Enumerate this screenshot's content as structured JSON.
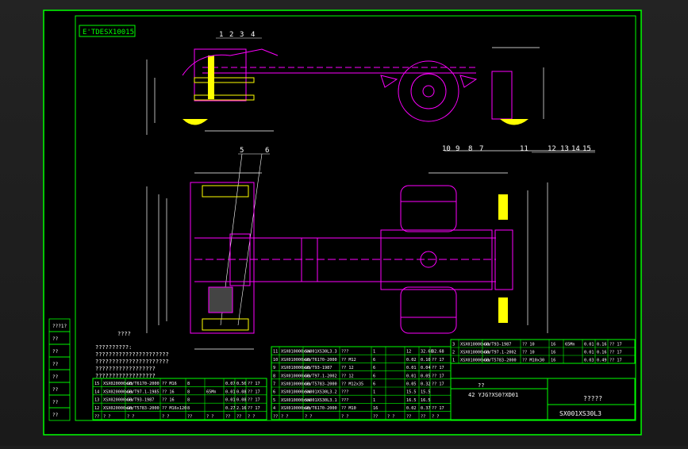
{
  "app": {
    "title": "Vehicle chassis layout drawing (CAD sheet)"
  },
  "colors": {
    "background": "#000000",
    "frame": "#00ff00",
    "dimension": "#ffffff",
    "chassis": "#ff00ff",
    "hub": "#ffff00"
  },
  "drawing": {
    "title_block_tag": "E'TDESX10015",
    "labels": {
      "label_1": "1",
      "label_2": "2",
      "label_3": "3",
      "label_4": "4",
      "label_5": "5",
      "label_6": "6",
      "label_7": "7",
      "label_8": "8",
      "label_9": "9",
      "label_10": "10",
      "label_11": "11",
      "label_12": "12",
      "label_13": "13",
      "label_14": "14",
      "label_15": "15"
    },
    "notes": {
      "n1": "??????????:",
      "n2": "??????????????????????",
      "n3": "??????????????????????",
      "n4": "??????????????????",
      "n5": "??????????????????",
      "n6": "????"
    },
    "title_block": {
      "drawing_no": "SX001XS30L3",
      "drawing_name": "?????",
      "code": "42 YJG?XS0?XD01",
      "caption": "??"
    },
    "left_strip": [
      "???1?",
      "??",
      "??",
      "??",
      "??",
      "??",
      "??",
      "??"
    ],
    "parts_left_table": [
      [
        "15",
        "XSX020000xxx",
        "GB/T6170-2000",
        "?? M16",
        "8",
        "",
        "0.07",
        "0.56",
        "?? 17"
      ],
      [
        "14",
        "XSX020000xxx",
        "GB/T97.1-1985",
        "?? 16",
        "8",
        "65Mn",
        "0.01",
        "0.08",
        "?? 17"
      ],
      [
        "13",
        "XSX020000xxx",
        "GB/T93-1987",
        "?? 16",
        "8",
        "",
        "0.01",
        "0.08",
        "?? 17"
      ],
      [
        "12",
        "XSX020000xxx",
        "GB/T5783-2000",
        "?? M16x120",
        "8",
        "",
        "0.27",
        "2.16",
        "?? 17"
      ],
      [
        "??",
        "? ?",
        "? ?",
        "? ?",
        "??",
        "? ?",
        "??",
        "??",
        "? ?"
      ]
    ],
    "parts_mid_table": [
      [
        "11",
        "XSX010000xxx",
        "SX001XS30L3.3",
        "???",
        "1",
        "",
        "12",
        "32.68",
        "32.68"
      ],
      [
        "10",
        "XSX010000xxx",
        "GB/T6170-2000",
        "?? M12",
        "6",
        "",
        "0.02",
        "0.10",
        "?? 17"
      ],
      [
        "9",
        "XSX010000xxx",
        "GB/T93-1987",
        "?? 12",
        "6",
        "",
        "0.01",
        "0.04",
        "?? 17"
      ],
      [
        "8",
        "XSX010000xxx",
        "GB/T97.1-2002",
        "?? 12",
        "6",
        "",
        "0.01",
        "0.05",
        "?? 17"
      ],
      [
        "7",
        "XSX010000xxx",
        "GB/T5783-2000",
        "?? M12x35",
        "6",
        "",
        "0.05",
        "0.32",
        "?? 17"
      ],
      [
        "6",
        "XSX010000xxx",
        "SX001XS30L3.2",
        "???",
        "1",
        "",
        "15.5",
        "15.5",
        ""
      ],
      [
        "5",
        "XSX010000xxx",
        "SX001XS30L3.1",
        "???",
        "1",
        "",
        "16.5",
        "16.5",
        ""
      ],
      [
        "4",
        "XSX010000xxx",
        "GB/T6170-2000",
        "?? M10",
        "16",
        "",
        "0.02",
        "0.37",
        "?? 17"
      ],
      [
        "??",
        "? ?",
        "? ?",
        "? ?",
        "??",
        "? ?",
        "??",
        "??",
        "? ?"
      ]
    ],
    "parts_right_table": [
      [
        "3",
        "XSX010000xxx",
        "GB/T93-1987",
        "?? 10",
        "16",
        "65Mn",
        "0.01",
        "0.16",
        "?? 17"
      ],
      [
        "2",
        "XSX010000xxx",
        "GB/T97.1-2002",
        "?? 10",
        "16",
        "",
        "0.01",
        "0.16",
        "?? 17"
      ],
      [
        "1",
        "XSX010000xxx",
        "GB/T5783-2000",
        "?? M10x30",
        "16",
        "",
        "0.03",
        "0.49",
        "?? 17"
      ]
    ]
  }
}
